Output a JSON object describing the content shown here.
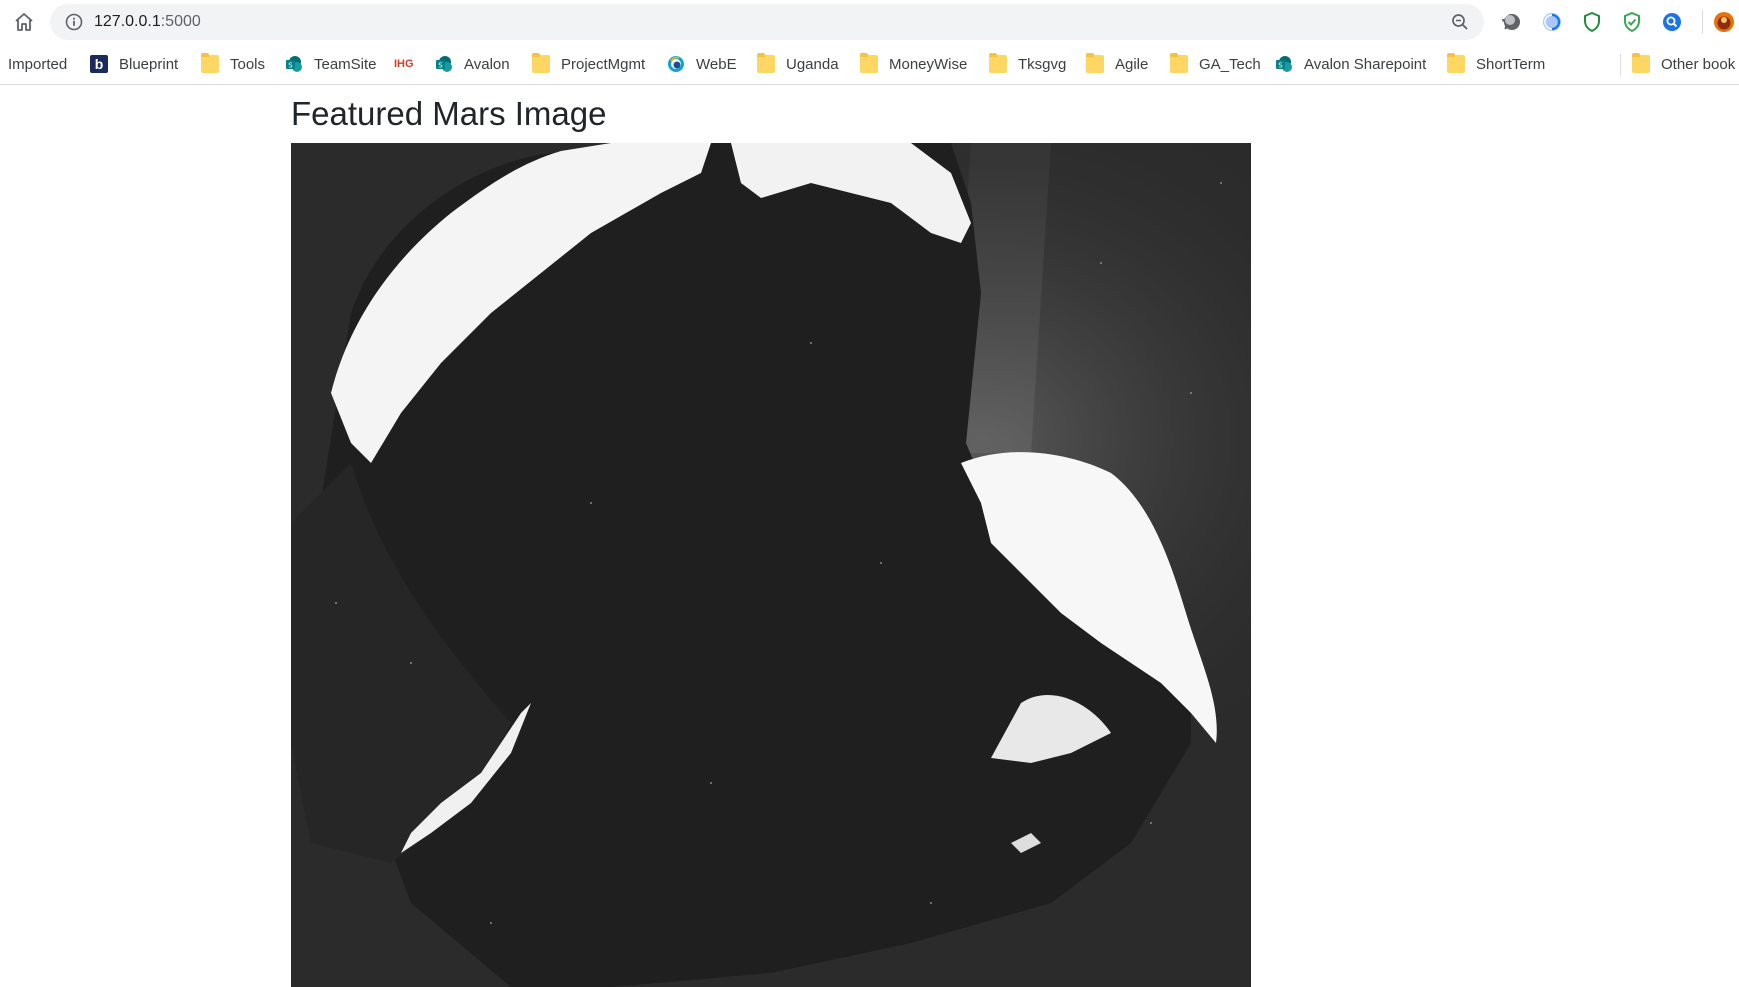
{
  "browser": {
    "url_host": "127.0.0.1",
    "url_port": ":5000",
    "extensions": [
      "circle-extension-icon",
      "refresh-extension-icon",
      "shield-extension-icon",
      "shield-check-extension-icon",
      "search-extension-icon",
      "profile-avatar-icon"
    ]
  },
  "bookmarks": {
    "items": [
      {
        "label": "Imported",
        "icon": "none"
      },
      {
        "label": "Blueprint",
        "icon": "blueprint-icon"
      },
      {
        "label": "Tools",
        "icon": "folder-icon"
      },
      {
        "label": "TeamSite",
        "icon": "sharepoint-icon"
      },
      {
        "label": "IHG",
        "icon": "ihg-icon"
      },
      {
        "label": "Avalon",
        "icon": "sharepoint-icon"
      },
      {
        "label": "ProjectMgmt",
        "icon": "folder-icon"
      },
      {
        "label": "WebE",
        "icon": "globe-icon"
      },
      {
        "label": "Uganda",
        "icon": "folder-icon"
      },
      {
        "label": "MoneyWise",
        "icon": "folder-icon"
      },
      {
        "label": "Tksgvg",
        "icon": "folder-icon"
      },
      {
        "label": "Agile",
        "icon": "folder-icon"
      },
      {
        "label": "GA_Tech",
        "icon": "folder-icon"
      },
      {
        "label": "Avalon Sharepoint",
        "icon": "sharepoint-icon"
      },
      {
        "label": "ShortTerm",
        "icon": "folder-icon"
      }
    ],
    "other_label": "Other book"
  },
  "page": {
    "title": "Featured Mars Image",
    "image_label": "featured-mars-image"
  },
  "colors": {
    "folder": "#fdd663",
    "sharepoint": "#038387",
    "omnibox_bg": "#f1f3f4",
    "image_bg": "#2a2a2a"
  }
}
